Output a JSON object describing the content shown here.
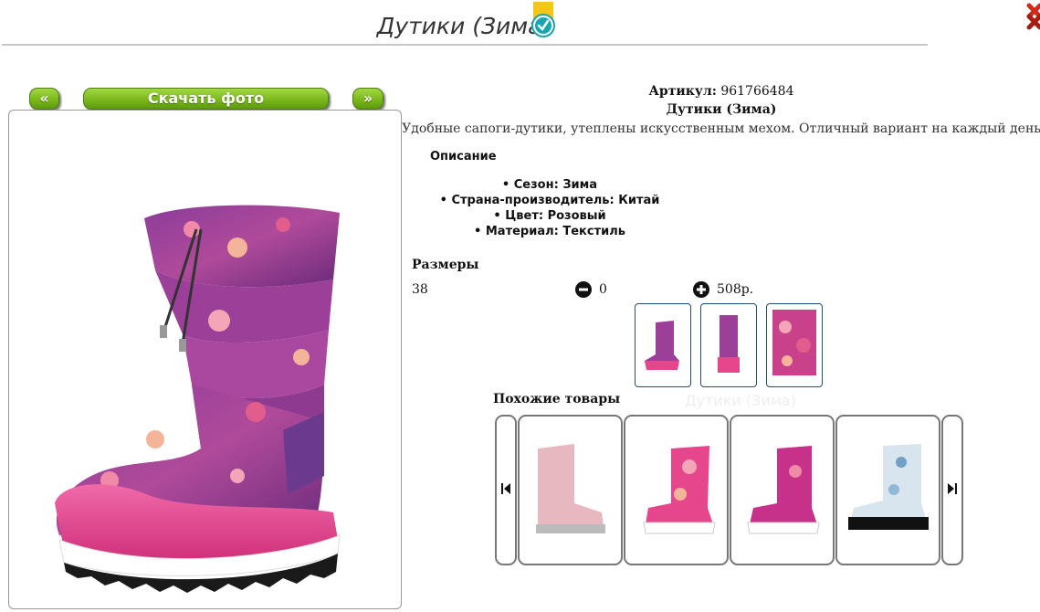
{
  "header": {
    "title": "Дутики (Зима)",
    "verified_icon": "verified-check-badge",
    "close_icon": "close-x-icon"
  },
  "gallery": {
    "prev_label": "«",
    "download_label": "Скачать фото",
    "next_label": "»",
    "main_image": "pink-floral-winter-boot"
  },
  "product": {
    "article_label": "Артикул:",
    "article_value": "961766484",
    "name": "Дутики (Зима)",
    "description": "Удобные сапоги-дутики, утеплены искусственным мехом. Отличный вариант на каждый день",
    "description_heading": "Описание",
    "attributes": [
      "Сезон: Зима",
      "Страна-производитель: Китай",
      "Цвет: Розовый",
      "Материал: Текстиль"
    ]
  },
  "sizes": {
    "heading": "Размеры",
    "rows": [
      {
        "size": "38",
        "quantity": "0",
        "price": "508р."
      }
    ],
    "minus_icon": "minus-circle-icon",
    "plus_icon": "plus-circle-icon"
  },
  "thumbnails": [
    "boot-side-view",
    "boot-back-view",
    "boot-fabric-closeup"
  ],
  "similar": {
    "heading": "Похожие товары",
    "ghost_title": "Дутики (Зима)",
    "items": [
      "pink-sequin-boot",
      "pink-floral-boot",
      "pink-magenta-boot",
      "black-white-floral-boot"
    ]
  },
  "colors": {
    "button_green": "#7dbb1d",
    "boot_pink": "#e6468c",
    "accent_teal": "#1aa6b0",
    "badge_yellow": "#f5c518",
    "close_red": "#d12a1a"
  }
}
